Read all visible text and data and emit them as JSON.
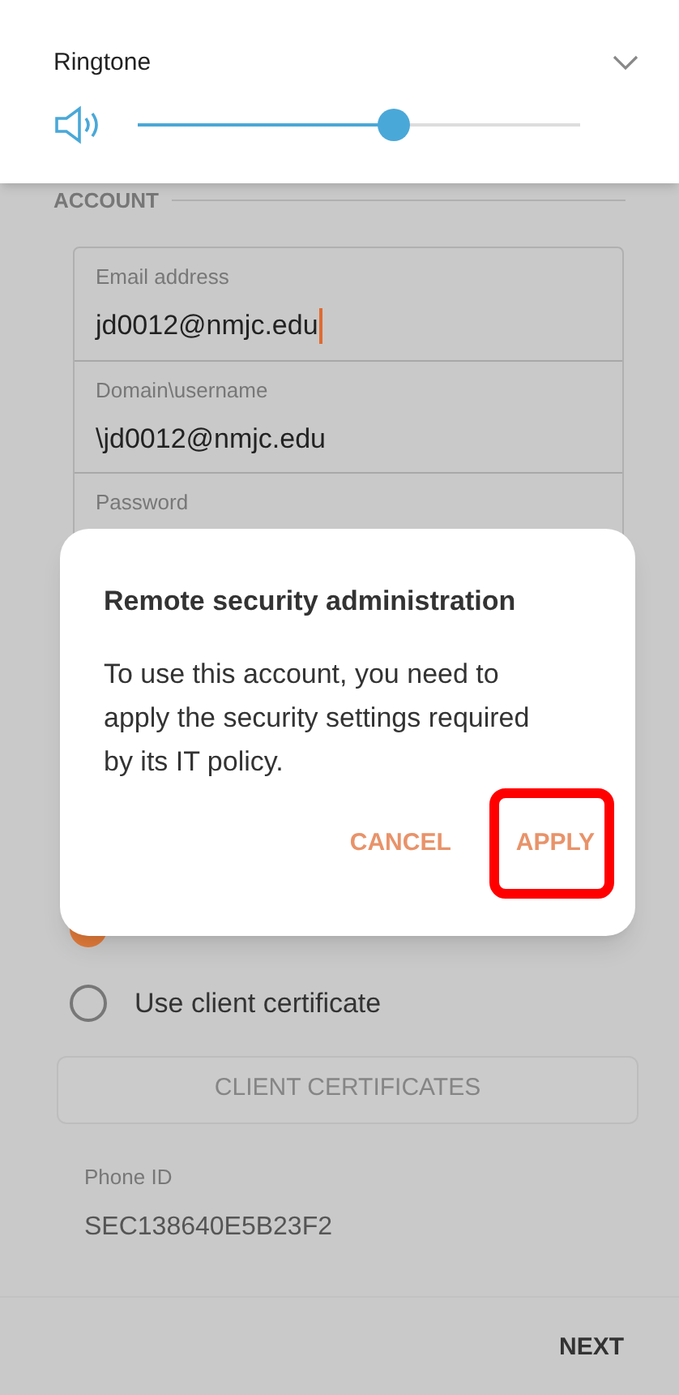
{
  "volume_panel": {
    "title": "Ringtone",
    "level": 0.58
  },
  "section": {
    "title": "ACCOUNT"
  },
  "fields": [
    {
      "label": "Email address",
      "value": "jd0012@nmjc.edu",
      "focused": true
    },
    {
      "label": "Domain\\username",
      "value": "\\jd0012@nmjc.edu",
      "focused": false
    },
    {
      "label": "Password",
      "focused": false
    }
  ],
  "radios": [
    {
      "selected": true
    },
    {
      "label": "Use client certificate",
      "selected": false
    }
  ],
  "certificates_button": {
    "label": "CLIENT CERTIFICATES",
    "disabled": true
  },
  "phone_id": {
    "label": "Phone ID",
    "value": "SEC138640E5B23F2"
  },
  "next_button": {
    "label": "NEXT"
  },
  "dialog": {
    "title": "Remote security administration",
    "message": "To use this account, you need to apply the security settings required by its IT policy.",
    "buttons": [
      {
        "label": "CANCEL",
        "highlighted": false
      },
      {
        "label": "APPLY",
        "highlighted": true
      }
    ]
  }
}
